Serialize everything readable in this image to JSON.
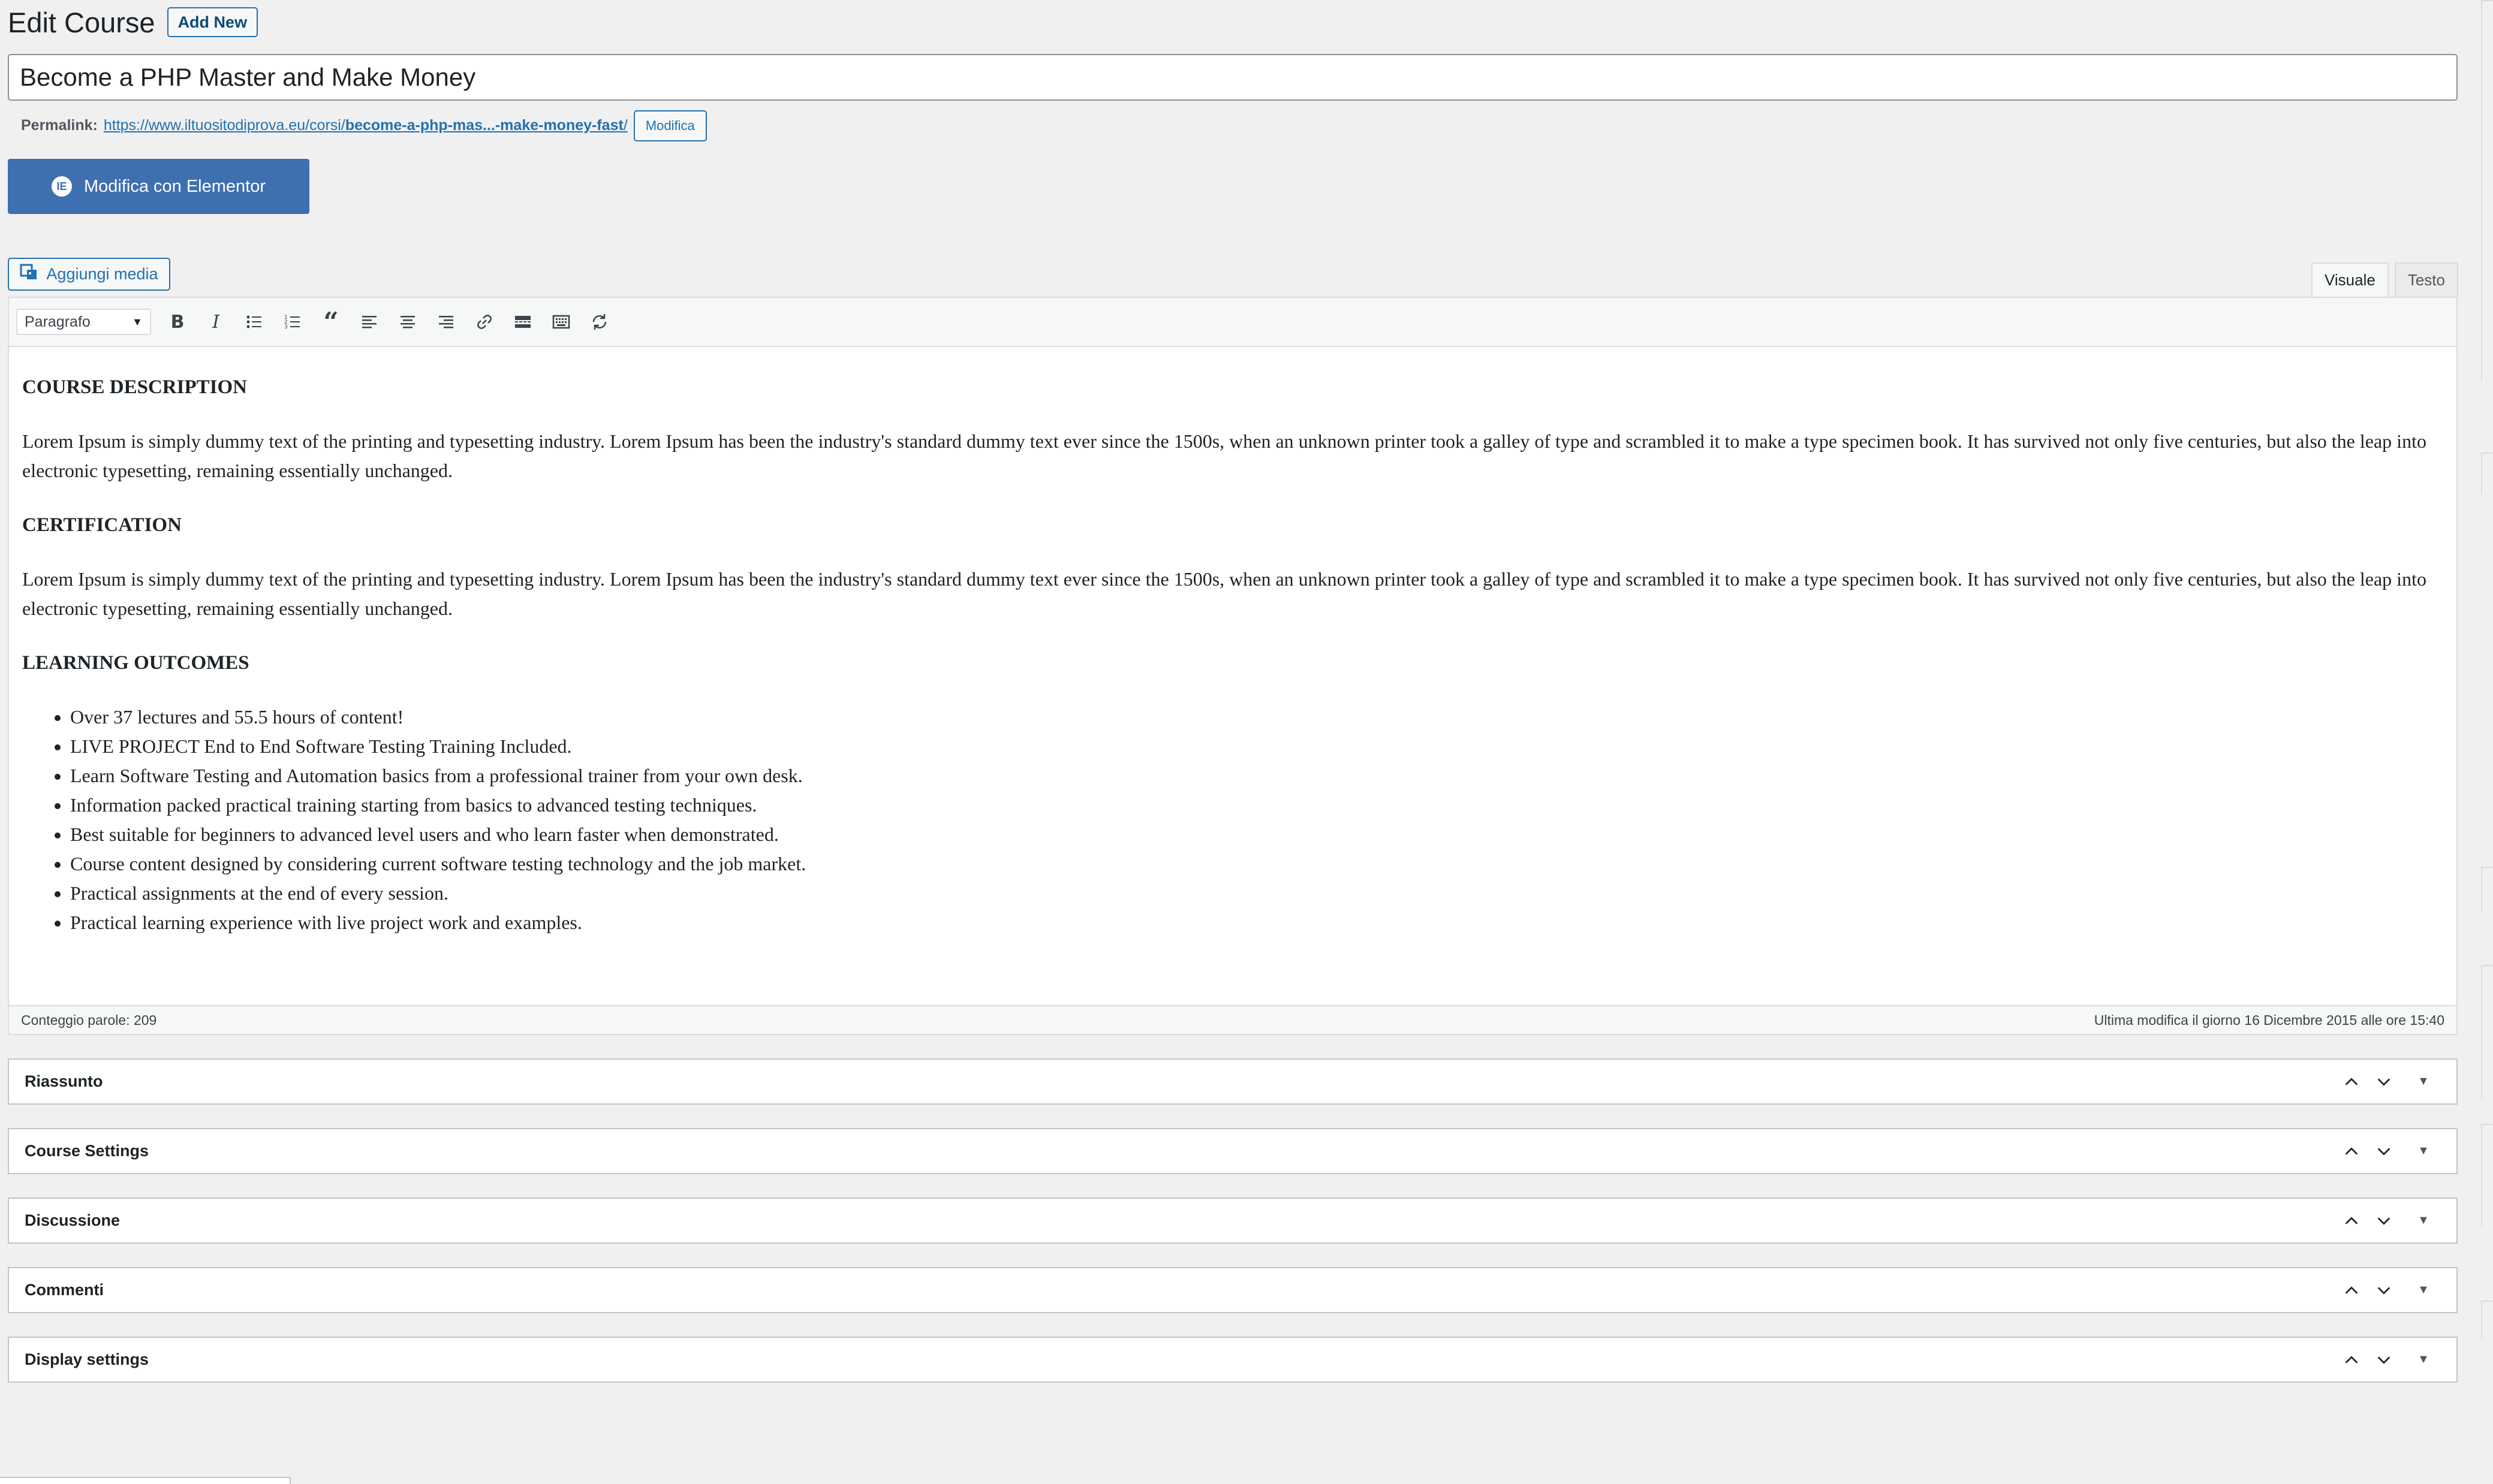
{
  "header": {
    "title": "Edit Course",
    "add_new": "Add New"
  },
  "post_title": "Become a PHP Master and Make Money",
  "permalink": {
    "label": "Permalink:",
    "url_base": "https://www.iltuositodiprova.eu/corsi/",
    "url_slug": "become-a-php-mas...-make-money-fast",
    "url_end": "/",
    "edit_button": "Modifica"
  },
  "elementor": {
    "label": "Modifica con Elementor",
    "logo": "IE"
  },
  "media": {
    "label": "Aggiungi media"
  },
  "tabs": {
    "visual": "Visuale",
    "text": "Testo"
  },
  "toolbar": {
    "format": "Paragrafo"
  },
  "content": {
    "heading1": "COURSE DESCRIPTION",
    "para1": "Lorem Ipsum is simply dummy text of the printing and typesetting industry. Lorem Ipsum has been the industry's standard dummy text ever since the 1500s, when an unknown printer took a galley of type and scrambled it to make a type specimen book. It has survived not only five centuries, but also the leap into electronic typesetting, remaining essentially unchanged.",
    "heading2": "CERTIFICATION",
    "para2": "Lorem Ipsum is simply dummy text of the printing and typesetting industry. Lorem Ipsum has been the industry's standard dummy text ever since the 1500s, when an unknown printer took a galley of type and scrambled it to make a type specimen book. It has survived not only five centuries, but also the leap into electronic typesetting, remaining essentially unchanged.",
    "heading3": "LEARNING OUTCOMES",
    "outcomes": [
      "Over 37 lectures and 55.5 hours of content!",
      "LIVE PROJECT End to End Software Testing Training Included.",
      "Learn Software Testing and Automation basics from a professional trainer from your own desk.",
      "Information packed practical training starting from basics to advanced testing techniques.",
      "Best suitable for beginners to advanced level users and who learn faster when demonstrated.",
      "Course content designed by considering current software testing technology and the job market.",
      "Practical assignments at the end of every session.",
      "Practical learning experience with live project work and examples."
    ]
  },
  "status": {
    "word_count": "Conteggio parole: 209",
    "last_modified": "Ultima modifica il giorno 16 Dicembre 2015 alle ore 15:40"
  },
  "metaboxes": [
    "Riassunto",
    "Course Settings",
    "Discussione",
    "Commenti",
    "Display settings"
  ]
}
